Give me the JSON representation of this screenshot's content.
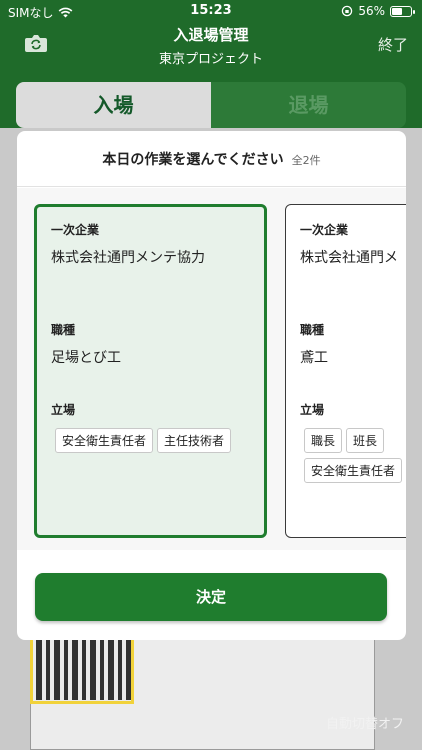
{
  "status_bar": {
    "carrier": "SIMなし",
    "time": "15:23",
    "battery": "56%",
    "battery_level": 0.56
  },
  "nav": {
    "title": "入退場管理",
    "subtitle": "東京プロジェクト",
    "close": "終了"
  },
  "segment": {
    "enter": "入場",
    "exit": "退場",
    "selected": "入場"
  },
  "modal": {
    "title": "本日の作業を選んでください",
    "count": "全2件",
    "cards": [
      {
        "selected": true,
        "company_label": "一次企業",
        "company": "株式会社通門メンテ協力",
        "job_label": "職種",
        "job": "足場とび工",
        "role_label": "立場",
        "roles": [
          "安全衛生責任者",
          "主任技術者"
        ]
      },
      {
        "selected": false,
        "company_label": "一次企業",
        "company": "株式会社通門メ",
        "job_label": "職種",
        "job": "鳶工",
        "role_label": "立場",
        "roles": [
          "職長",
          "班長",
          "安全衛生責任者"
        ]
      }
    ],
    "decide": "決定"
  },
  "camera": {
    "auto_toggle": "自動切替オフ"
  },
  "colors": {
    "brand_green": "#1f7d2e",
    "header_green": "#1f6b2a",
    "selected_card_bg": "#e8f2ea"
  }
}
